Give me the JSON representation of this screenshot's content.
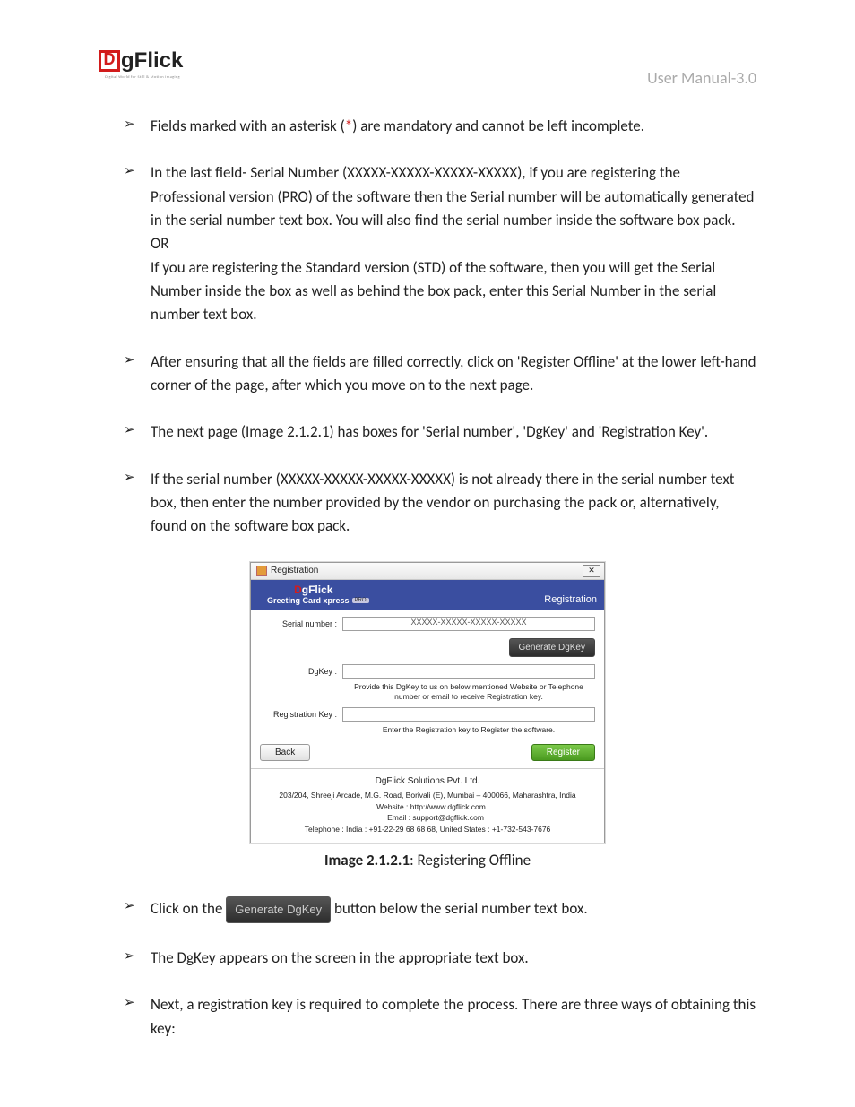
{
  "header": {
    "logo_text": "DgFlick",
    "logo_tagline": "Digital World for Still & Motion Imaging",
    "manual_label": "User Manual-3.0"
  },
  "bullets_top": [
    {
      "pre": "Fields marked with an asterisk (",
      "star": "*",
      "post": ") are mandatory and cannot be left incomplete."
    },
    {
      "full": "In the last field- Serial Number (XXXXX-XXXXX-XXXXX-XXXXX), if you are registering the Professional version (PRO) of the software then the Serial number will be automatically generated in the serial number text box. You will also find the serial number inside the software box pack.\nOR\nIf you are registering the Standard version (STD) of the software, then you will get the Serial Number inside the box as well as behind the box pack, enter this Serial Number in the serial number text box."
    },
    {
      "full": "After ensuring that all the fields are filled correctly, click on 'Register Offline' at the lower left-hand corner of the page, after which you move on to the next page."
    },
    {
      "full": "The next page (Image 2.1.2.1) has boxes for 'Serial number', 'DgKey' and 'Registration Key'."
    },
    {
      "full": "If the serial number (XXXXX-XXXXX-XXXXX-XXXXX) is not already there in the serial number text box, then enter the number provided by the vendor on purchasing the pack or, alternatively, found on the software box pack."
    }
  ],
  "dialog": {
    "titlebar": "Registration",
    "brand": "DgFlick",
    "product": "Greeting Card xpress",
    "pro_badge": "PRO",
    "heading": "Registration",
    "serial_label": "Serial number :",
    "serial_value": "XXXXX-XXXXX-XXXXX-XXXXX",
    "generate_btn": "Generate DgKey",
    "dgkey_label": "DgKey :",
    "dgkey_note": "Provide this DgKey to us on below mentioned Website or Telephone number or email to receive Registration key.",
    "regkey_label": "Registration Key :",
    "regkey_note": "Enter the Registration key to Register the software.",
    "back_btn": "Back",
    "register_btn": "Register",
    "company": "DgFlick Solutions Pvt. Ltd.",
    "address": "203/204, Shreeji Arcade, M.G. Road, Borivali (E), Mumbai – 400066, Maharashtra, India",
    "website_lbl": "Website :",
    "website": "http://www.dgflick.com",
    "email_lbl": "Email :",
    "email": "support@dgflick.com",
    "telephone": "Telephone : India : +91-22-29 68 68 68, United States : +1-732-543-7676"
  },
  "caption": {
    "bold": "Image 2.1.2.1",
    "rest": ": Registering Offline"
  },
  "bullets_bottom": [
    {
      "pre": "Click on the ",
      "btn": "Generate DgKey",
      "post": " button below the serial number text box."
    },
    {
      "full": "The DgKey appears on the screen in the appropriate text box."
    },
    {
      "full": "Next, a registration key is required to complete the process. There are three ways of obtaining this key:"
    }
  ]
}
